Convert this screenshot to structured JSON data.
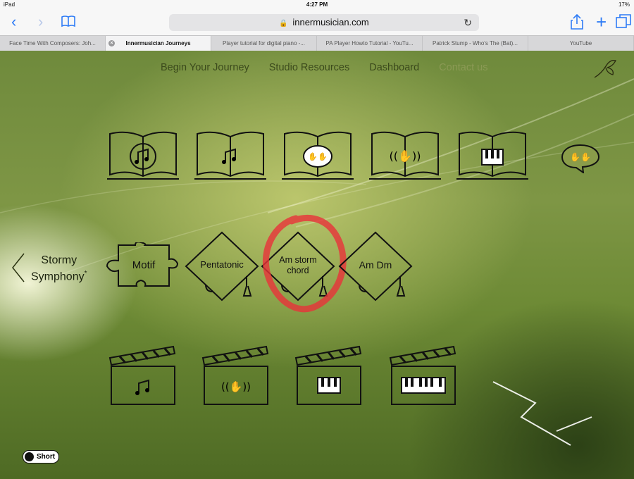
{
  "status_bar": {
    "device": "iPad",
    "time": "4:27 PM",
    "battery": "17%"
  },
  "browser": {
    "url": "innermusician.com",
    "tabs": [
      {
        "label": "Face Time With Composers: Joh..."
      },
      {
        "label": "Innermusician Journeys"
      },
      {
        "label": "Player tutorial for digital piano -..."
      },
      {
        "label": "PA Player Howto Tutorial - YouTu..."
      },
      {
        "label": "Patrick Stump - Who's The (Bat)..."
      },
      {
        "label": "YouTube"
      }
    ]
  },
  "nav": {
    "items": [
      "Begin Your Journey",
      "Studio Resources",
      "Dashboard",
      "Contact us"
    ]
  },
  "journey": {
    "title_line1": "Stormy",
    "title_line2": "Symphony",
    "title_mark": "*"
  },
  "lessons": [
    {
      "label": "Motif",
      "shape": "puzzle"
    },
    {
      "label": "Pentatonic",
      "shape": "cap"
    },
    {
      "label_line1": "Am storm",
      "label_line2": "chord",
      "shape": "cap",
      "highlighted": true
    },
    {
      "label": "Am Dm",
      "shape": "cap"
    }
  ],
  "books_row": [
    "music-note-bubble",
    "music-note",
    "hands-bubble",
    "hands-waves",
    "piano-keys",
    "hands-bubble-standalone"
  ],
  "clapper_row": [
    "music-note",
    "hands-waves",
    "piano-keys-small",
    "piano-keys-large"
  ],
  "toggle": {
    "label": "Short"
  },
  "colors": {
    "accent": "#2f7cf6",
    "highlight": "#e8323a",
    "ink": "#111111"
  }
}
